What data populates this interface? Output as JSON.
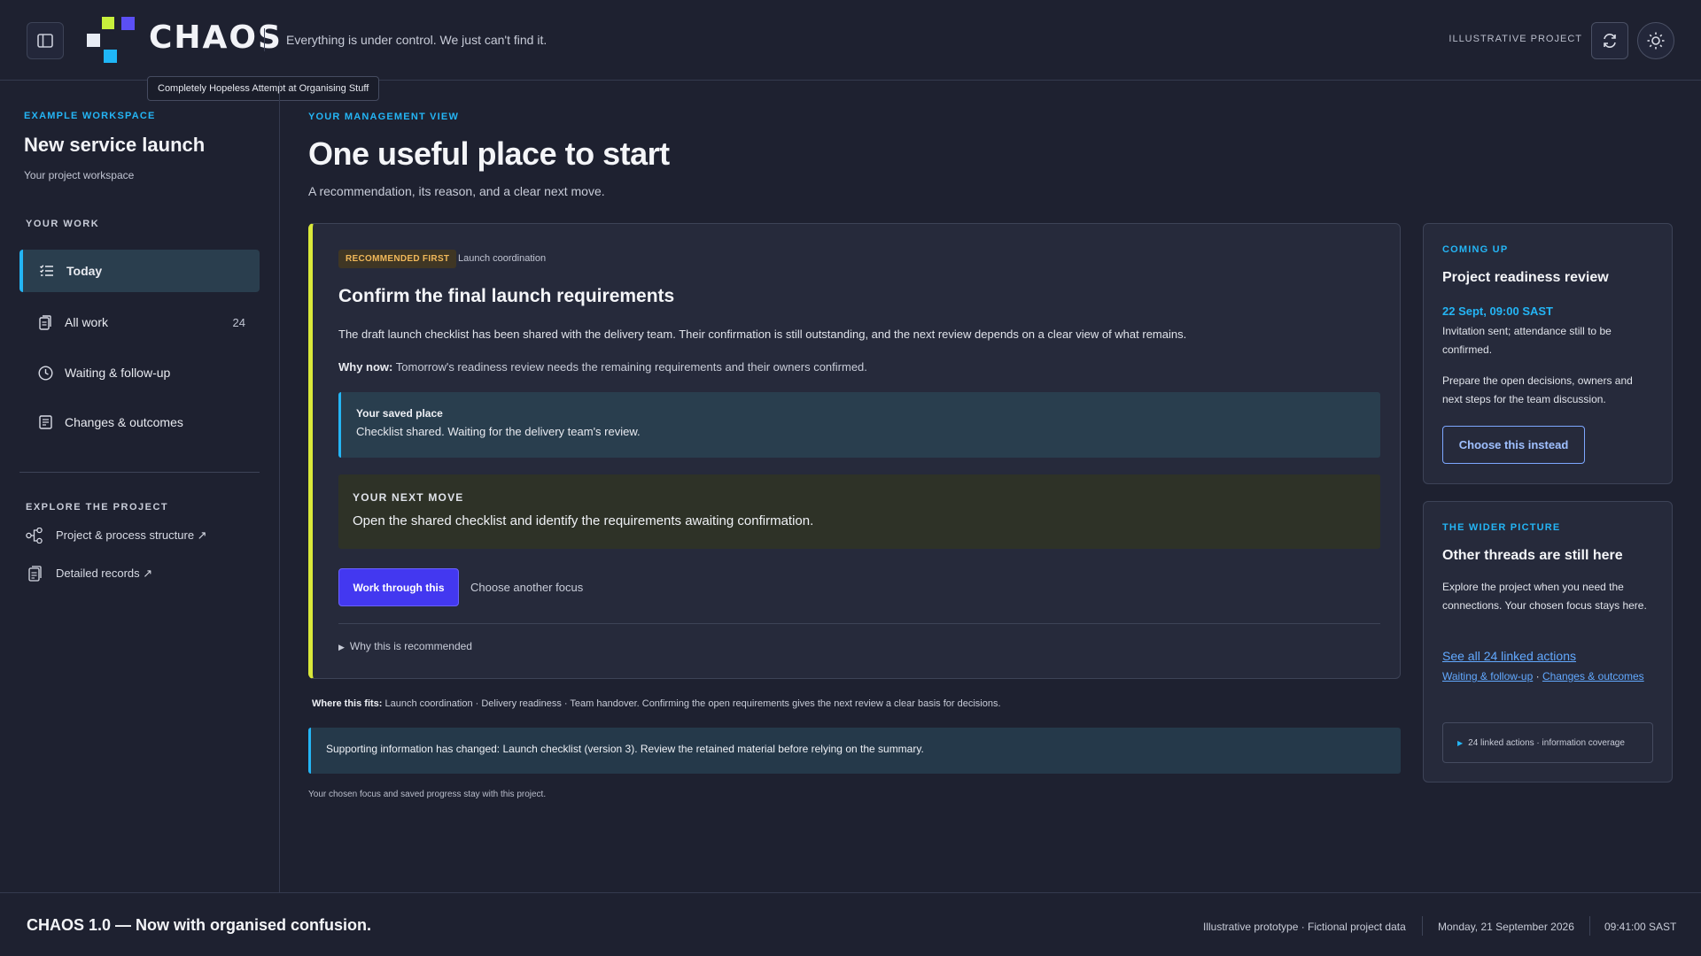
{
  "header": {
    "brand": "CHAOS",
    "tagline": "Everything is under control. We just can't find it.",
    "tooltip": "Completely Hopeless Attempt at Organising Stuff",
    "project_label": "ILLUSTRATIVE PROJECT",
    "icons": {
      "sidebar_toggle": "sidebar-icon",
      "refresh": "refresh-icon",
      "theme": "sun-icon"
    },
    "logo_colors": [
      "#c8f03c",
      "#5b4ff5",
      "#e8ecf4",
      "#1fb6f6"
    ]
  },
  "sidebar": {
    "workspace_label": "EXAMPLE WORKSPACE",
    "workspace_title": "New service launch",
    "workspace_sub": "Your project workspace",
    "your_work_label": "YOUR WORK",
    "items": [
      {
        "label": "Today",
        "icon": "list-icon",
        "active": true
      },
      {
        "label": "All work",
        "icon": "document-icon",
        "count": "24"
      },
      {
        "label": "Waiting & follow-up",
        "icon": "clock-icon"
      },
      {
        "label": "Changes & outcomes",
        "icon": "notes-icon"
      }
    ],
    "explore_label": "EXPLORE THE PROJECT",
    "explore": [
      {
        "label": "Project & process structure ↗",
        "icon": "structure-icon"
      },
      {
        "label": "Detailed records ↗",
        "icon": "records-icon"
      }
    ]
  },
  "main": {
    "label": "YOUR MANAGEMENT VIEW",
    "title": "One useful place to start",
    "subtitle": "A recommendation, its reason, and a clear next move.",
    "card": {
      "badge": "RECOMMENDED FIRST",
      "context": "Launch coordination",
      "title": "Confirm the final launch requirements",
      "description": "The draft launch checklist has been shared with the delivery team. Their confirmation is still outstanding, and the next review depends on a clear view of what remains.",
      "why_label": "Why now:",
      "why_text": " Tomorrow's readiness review needs the remaining requirements and their owners confirmed.",
      "saved_title": "Your saved place",
      "saved_text": "Checklist shared. Waiting for the delivery team's review.",
      "next_title": "YOUR NEXT MOVE",
      "next_text": "Open the shared checklist and identify the requirements awaiting confirmation.",
      "primary_btn": "Work through this",
      "secondary_link": "Choose another focus",
      "why_toggle": "Why this is recommended"
    },
    "where_label": "Where this fits:",
    "where_text": " Launch coordination · Delivery readiness · Team handover. Confirming the open requirements gives the next review a clear basis for decisions.",
    "info_changed": "Supporting information has changed: Launch checklist (version 3). Review the retained material before relying on the summary.",
    "footnote": "Your chosen focus and saved progress stay with this project."
  },
  "right": {
    "coming": {
      "label": "COMING UP",
      "title": "Project readiness review",
      "date": "22 Sept, 09:00 SAST",
      "status": "Invitation sent; attendance still to be confirmed.",
      "prep": "Prepare the open decisions, owners and next steps for the team discussion.",
      "button": "Choose this instead"
    },
    "wider": {
      "label": "THE WIDER PICTURE",
      "title": "Other threads are still here",
      "text": "Explore the project when you need the connections. Your chosen focus stays here.",
      "link_all": "See all 24 linked actions",
      "link_waiting": "Waiting & follow-up",
      "link_dot": " · ",
      "link_changes": "Changes & outcomes",
      "coverage": "24 linked actions · information coverage"
    }
  },
  "footer": {
    "brandline": "CHAOS 1.0 — Now with organised confusion.",
    "meta1": "Illustrative prototype · Fictional project data",
    "date": "Monday, 21 September 2026",
    "time": "09:41:00 SAST"
  }
}
